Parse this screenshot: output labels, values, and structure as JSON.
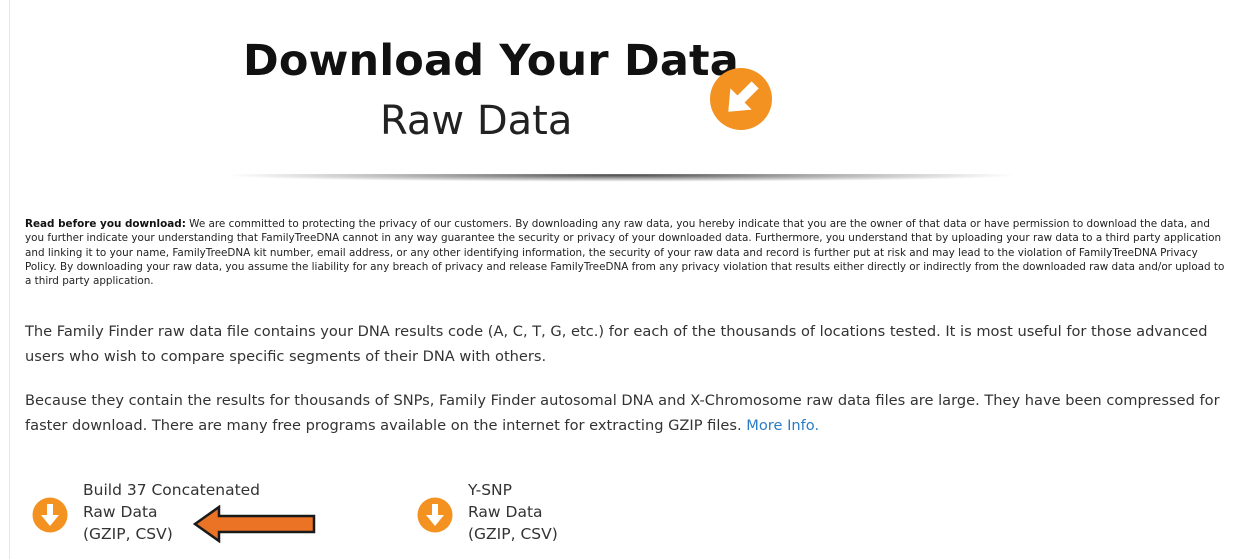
{
  "header": {
    "title": "Download Your Data",
    "subtitle": "Raw Data",
    "icon": "download-arrow-icon"
  },
  "disclaimer": {
    "lead": "Read before you download:",
    "text": " We are committed to protecting the privacy of our customers. By downloading any raw data, you hereby indicate that you are the owner of that data or have permission to download the data, and you further indicate your understanding that FamilyTreeDNA cannot in any way guarantee the security or privacy of your downloaded data. Furthermore, you understand that by uploading your raw data to a third party application and linking it to your name, FamilyTreeDNA kit number, email address, or any other identifying information, the security of your raw data and record is further put at risk and may lead to the violation of FamilyTreeDNA Privacy Policy. By downloading your raw data, you assume the liability for any breach of privacy and release FamilyTreeDNA from any privacy violation that results either directly or indirectly from the downloaded raw data and/or upload to a third party application."
  },
  "content": {
    "paragraph1": "The Family Finder raw data file contains your DNA results code (A, C, T, G, etc.) for each of the thousands of locations tested. It is most useful for those advanced users who wish to compare specific segments of their DNA with others.",
    "paragraph2": "Because they contain the results for thousands of SNPs, Family Finder autosomal DNA and X-Chromosome raw data files are large. They have been compressed for faster download. There are many free programs available on the internet for extracting GZIP files.",
    "more_info": "More Info."
  },
  "downloads": [
    {
      "line1": "Build 37 Concatenated",
      "line2": "Raw Data",
      "line3": "(GZIP, CSV)",
      "icon": "download-icon"
    },
    {
      "line1": "Y-SNP",
      "line2": "Raw Data",
      "line3": "(GZIP, CSV)",
      "icon": "download-icon"
    }
  ],
  "colors": {
    "accent_orange": "#f39121",
    "link_blue": "#2b7cc7",
    "annotation_arrow": "#ea7326"
  }
}
